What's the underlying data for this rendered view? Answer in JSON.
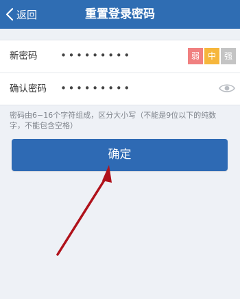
{
  "header": {
    "back_label": "返回",
    "title": "重置登录密码",
    "color": "#2f6db3"
  },
  "form": {
    "new_password": {
      "label": "新密码",
      "value": "•••••••••"
    },
    "confirm_password": {
      "label": "确认密码",
      "value": "•••••••••"
    },
    "strength": [
      {
        "label": "弱",
        "color": "#f08080"
      },
      {
        "label": "中",
        "color": "#f6b63c"
      },
      {
        "label": "强",
        "color": "#c4c4c4"
      }
    ]
  },
  "hint": "密码由6−16个字符组成，区分大小写（不能是9位以下的纯数字，不能包含空格）",
  "confirm_button": {
    "label": "确定",
    "color": "#2e6ab4"
  },
  "annotation": {
    "arrow_color": "#b0121b"
  },
  "icons": [
    "chevron-left-icon",
    "eye-icon"
  ]
}
